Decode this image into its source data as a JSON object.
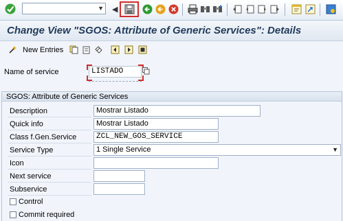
{
  "toolbar": {
    "command_value": "",
    "icons": [
      "enter-check",
      "save",
      "back",
      "exit",
      "cancel",
      "print",
      "find",
      "find-next",
      "first-page",
      "previous-page",
      "next-page",
      "last-page",
      "new-session",
      "shortcut",
      "help"
    ]
  },
  "title": "Change View \"SGOS: Attribute of Generic Services\": Details",
  "app_toolbar": {
    "new_entries_label": "New Entries"
  },
  "service": {
    "label": "Name of service",
    "value": "LISTADO"
  },
  "group": {
    "title": "SGOS: Attribute of Generic Services",
    "fields": {
      "description": {
        "label": "Description",
        "value": "Mostrar Listado"
      },
      "quick_info": {
        "label": "Quick info",
        "value": "Mostrar Listado"
      },
      "class": {
        "label": "Class f.Gen.Service",
        "value": "ZCL_NEW_GOS_SERVICE"
      },
      "service_type": {
        "label": "Service Type",
        "value": "1 Single Service"
      },
      "icon": {
        "label": "Icon",
        "value": ""
      },
      "next_service": {
        "label": "Next service",
        "value": ""
      },
      "subservice": {
        "label": "Subservice",
        "value": ""
      },
      "control": {
        "label": "Control",
        "checked": false
      },
      "commit_required": {
        "label": "Commit required",
        "checked": false
      }
    }
  },
  "colors": {
    "title": "#223b5c",
    "highlight": "#d12c2c",
    "background": "#f1f5fb"
  }
}
